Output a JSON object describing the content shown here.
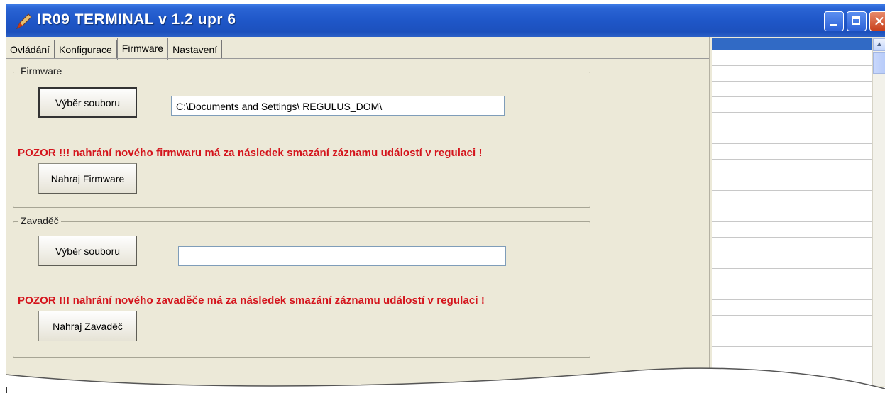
{
  "window": {
    "title": "IR09 TERMINAL v 1.2 upr 6",
    "controls": {
      "close_glyph": "✕"
    },
    "colors": {
      "titlebar": "#1f57c8",
      "warning": "#d4141c",
      "list_selection": "#316ac5"
    }
  },
  "tabs": [
    {
      "label": "Ovládání"
    },
    {
      "label": "Konfigurace"
    },
    {
      "label": "Firmware",
      "active": true
    },
    {
      "label": "Nastavení"
    }
  ],
  "firmware": {
    "group_title": "Firmware",
    "select_button": "Výběr souboru",
    "path_value": "C:\\Documents and Settings\\ REGULUS_DOM\\",
    "warning": "POZOR !!! nahrání nového firmwaru má za následek smazání záznamu událostí v regulaci !",
    "upload_button": "Nahraj Firmware"
  },
  "loader": {
    "group_title": "Zavaděč",
    "select_button": "Výběr souboru",
    "path_value": "",
    "warning": "POZOR !!! nahrání nového zavaděče má za následek smazání záznamu událostí v regulaci !",
    "upload_button": "Nahraj Zavaděč"
  },
  "icons": {
    "app": "pen-app-icon",
    "minimize": "minimize-icon",
    "maximize": "maximize-icon",
    "close": "close-icon",
    "scroll_up": "scroll-up-arrow-icon"
  }
}
